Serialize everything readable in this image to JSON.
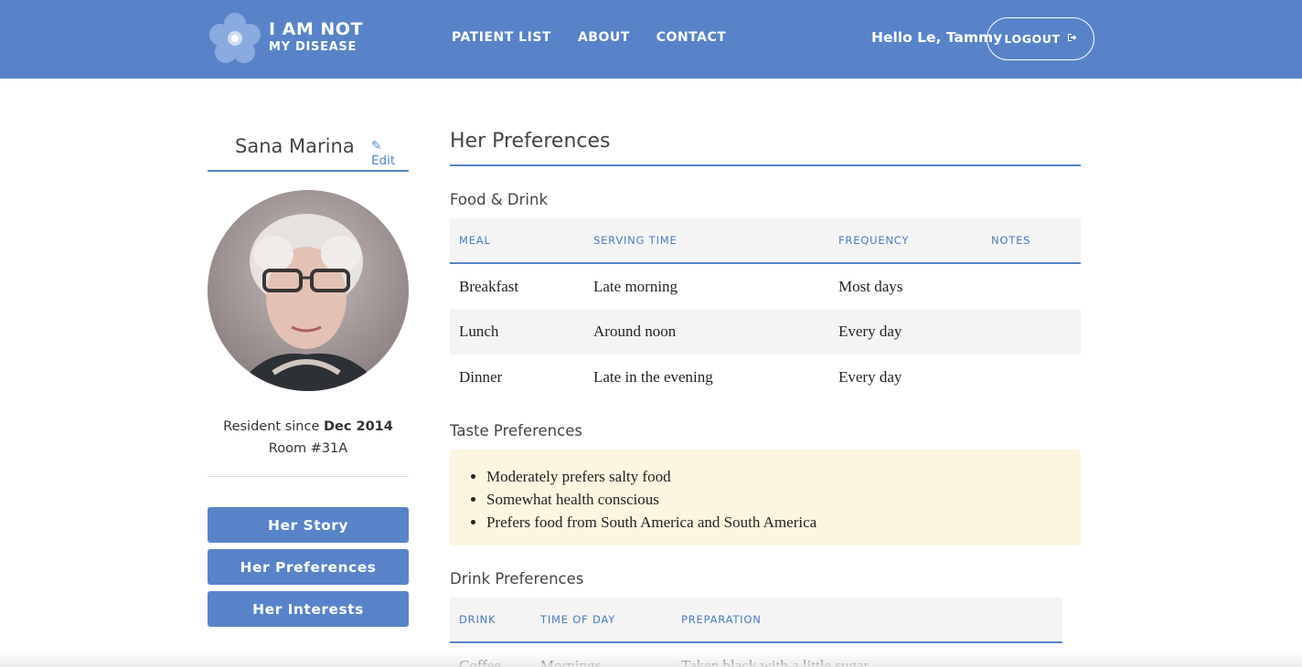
{
  "header": {
    "logo_line1": "I AM NOT",
    "logo_line2": "MY DISEASE",
    "nav": [
      "PATIENT LIST",
      "ABOUT",
      "CONTACT"
    ],
    "greeting": "Hello Le, Tammy",
    "logout_label": "LOGOUT",
    "logout_icon": "sign-out-icon"
  },
  "patient": {
    "name": "Sana Marina",
    "edit_label": "Edit",
    "resident_prefix": "Resident since",
    "resident_since": "Dec 2014",
    "room": "Room #31A"
  },
  "sidebar_buttons": [
    "Her Story",
    "Her Preferences",
    "Her Interests"
  ],
  "main": {
    "title": "Her Preferences",
    "food": {
      "title": "Food & Drink",
      "columns": [
        "MEAL",
        "SERVING TIME",
        "FREQUENCY",
        "NOTES"
      ],
      "rows": [
        [
          "Breakfast",
          "Late morning",
          "Most days",
          ""
        ],
        [
          "Lunch",
          "Around noon",
          "Every day",
          ""
        ],
        [
          "Dinner",
          "Late in the evening",
          "Every day",
          ""
        ]
      ]
    },
    "taste": {
      "title": "Taste Preferences",
      "items": [
        "Moderately prefers salty food",
        "Somewhat health conscious",
        "Prefers food from South America and South America"
      ]
    },
    "drink": {
      "title": "Drink Preferences",
      "columns": [
        "DRINK",
        "TIME OF DAY",
        "PREPARATION"
      ],
      "rows": [
        [
          "Coffee",
          "Mornings",
          "Taken black with a little sugar"
        ]
      ]
    }
  },
  "colors": {
    "brand_blue": "#5883c8",
    "highlight_bg": "#fcf6e0",
    "table_header_bg": "#f4f4f4"
  }
}
